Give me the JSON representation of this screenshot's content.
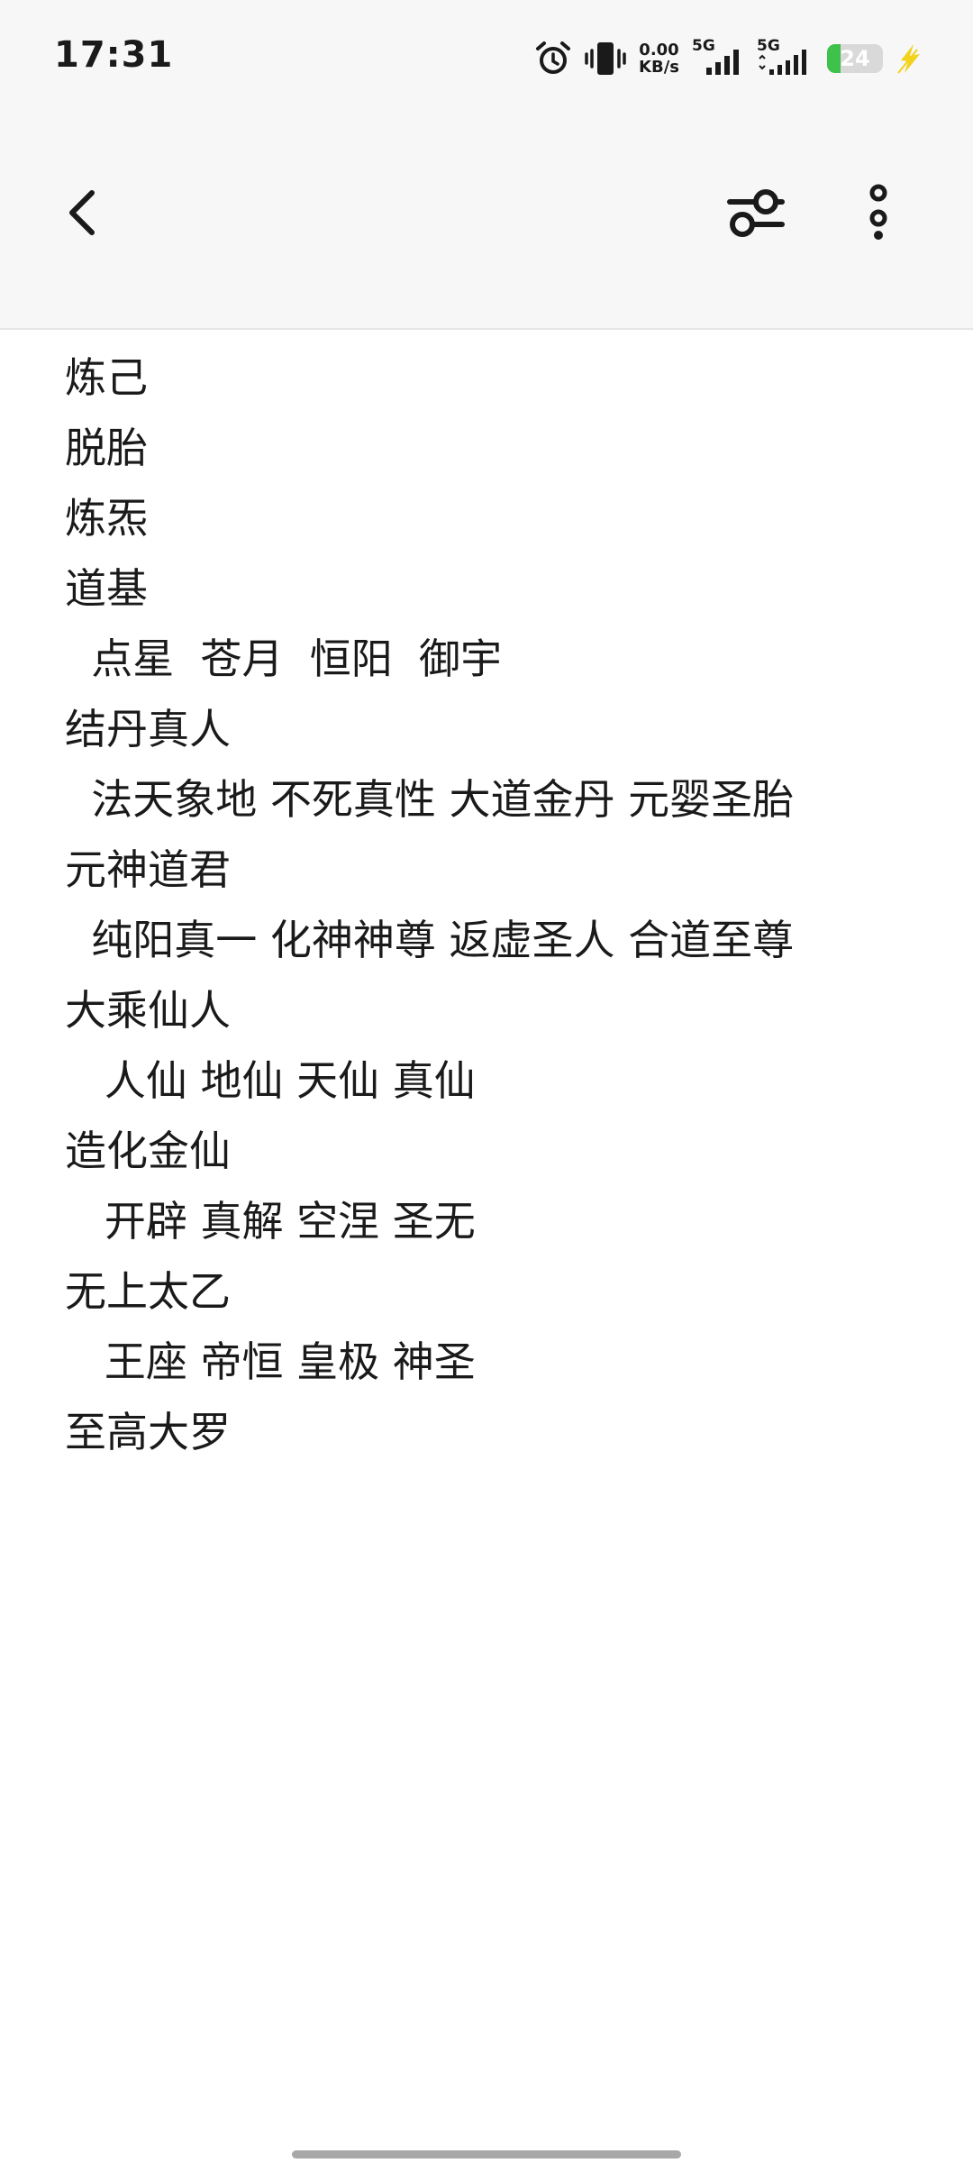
{
  "status_bar": {
    "time": "17:31",
    "net_speed_value": "0.00",
    "net_speed_unit": "KB/s",
    "sim1_label": "5G",
    "sim2_label": "5G",
    "battery_level": 24,
    "battery_text": "24",
    "icons": [
      "alarm-icon",
      "vibrate-icon",
      "signal-icon",
      "signal-icon",
      "battery-icon",
      "charging-icon"
    ]
  },
  "app_bar": {
    "icons": [
      "chevron-left-icon",
      "filter-settings-icon",
      "more-vertical-icon"
    ]
  },
  "note": {
    "lines": [
      "炼己",
      "脱胎",
      "炼炁",
      "道基",
      "  点星  苍月  恒阳  御宇",
      "结丹真人",
      "  法天象地 不死真性 大道金丹 元婴圣胎",
      "元神道君",
      "  纯阳真一 化神神尊 返虚圣人 合道至尊",
      "大乘仙人",
      "   人仙 地仙 天仙 真仙",
      "造化金仙",
      "   开辟 真解 空涅 圣无",
      "无上太乙",
      "   王座 帝恒 皇极 神圣",
      "至高大罗"
    ]
  },
  "colors": {
    "bar_background": "#f7f7f7",
    "text": "#1a1a1a",
    "battery_green": "#3ec24c",
    "charging_yellow": "#f2d21b"
  }
}
